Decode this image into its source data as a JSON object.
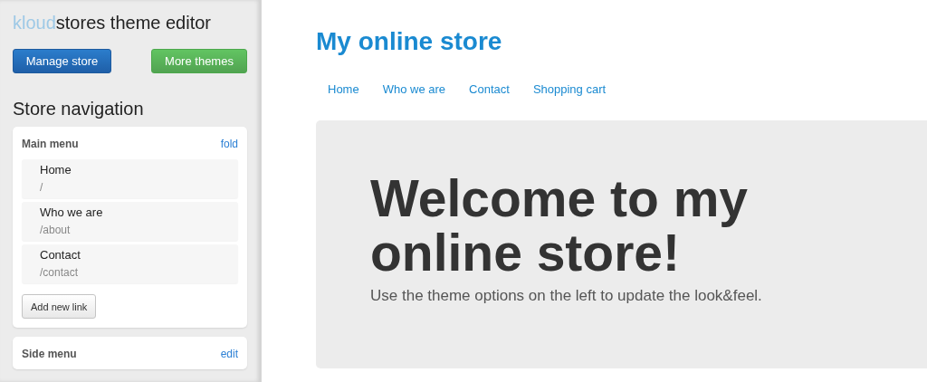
{
  "sidebar": {
    "title_brand": "kloud",
    "title_rest": "stores theme editor",
    "buttons": [
      {
        "label": "Manage store",
        "kind": "primary"
      },
      {
        "label": "More themes",
        "kind": "success"
      }
    ],
    "section_title": "Store navigation",
    "menus": [
      {
        "title": "Main menu",
        "action": "fold",
        "links": [
          {
            "name": "Home",
            "path": "/"
          },
          {
            "name": "Who we are",
            "path": "/about"
          },
          {
            "name": "Contact",
            "path": "/contact"
          }
        ],
        "add_button": "Add new link"
      },
      {
        "title": "Side menu",
        "action": "edit"
      }
    ]
  },
  "store": {
    "title": "My online store",
    "nav": [
      "Home",
      "Who we are",
      "Contact",
      "Shopping cart"
    ],
    "hero": {
      "heading": "Welcome to my online store!",
      "text": "Use the theme options on the left to update the look&feel."
    }
  }
}
